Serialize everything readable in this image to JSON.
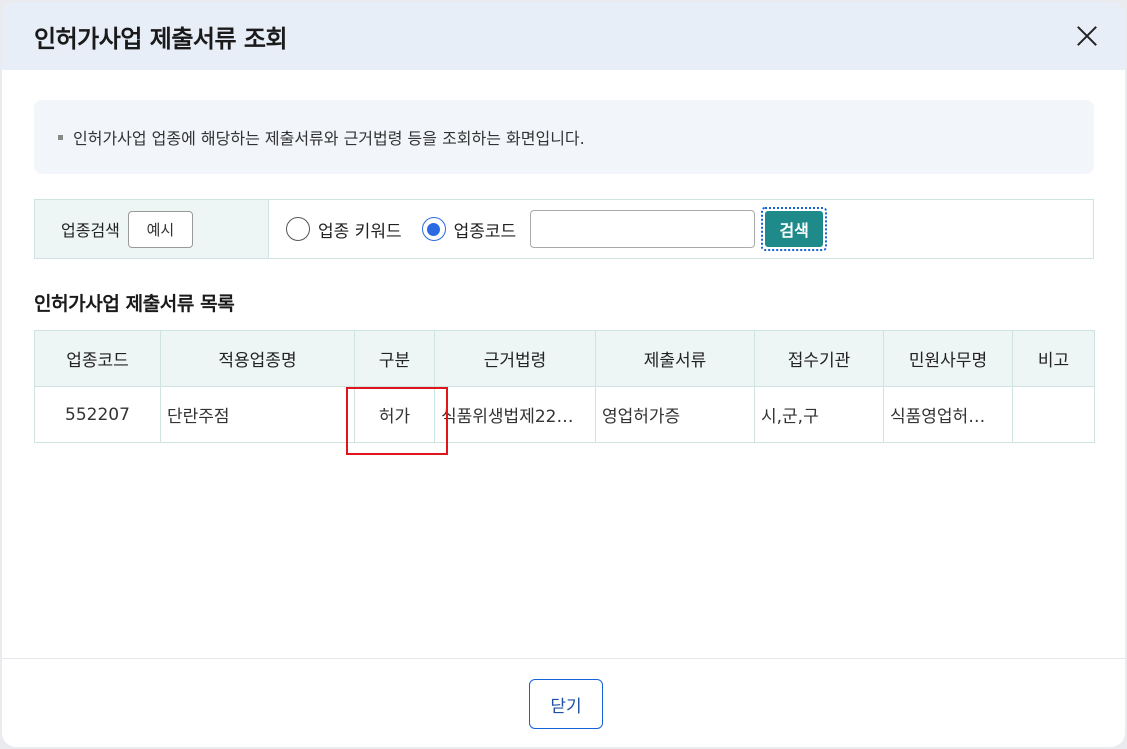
{
  "modal": {
    "title": "인허가사업 제출서류 조회"
  },
  "info": {
    "text": "인허가사업 업종에 해당하는 제출서류와 근거법령 등을 조회하는 화면입니다."
  },
  "search": {
    "label": "업종검색",
    "example_label": "예시",
    "radio_keyword_label": "업종 키워드",
    "radio_code_label": "업종코드",
    "selected_option": "업종코드",
    "input_value": "",
    "search_label": "검색"
  },
  "list": {
    "title": "인허가사업 제출서류 목록",
    "columns": [
      "업종코드",
      "적용업종명",
      "구분",
      "근거법령",
      "제출서류",
      "접수기관",
      "민원사무명",
      "비고"
    ],
    "rows": [
      [
        "552207",
        "단란주점",
        "허가",
        "식품위생법제22…",
        "영업허가증",
        "시,군,구",
        "식품영업허…",
        ""
      ]
    ]
  },
  "footer": {
    "close_label": "닫기"
  },
  "colors": {
    "header_bg": "#e8eef7",
    "accent_teal": "#1f8a8a",
    "radio_blue": "#2a6be3",
    "highlight_red": "#e0151b"
  }
}
